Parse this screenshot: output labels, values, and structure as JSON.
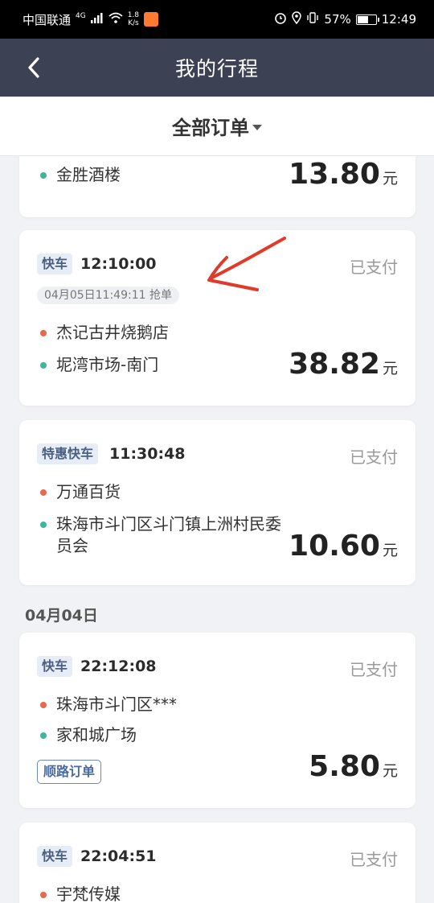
{
  "status_bar": {
    "carrier": "中国联通",
    "network": "4G",
    "speed_value": "1.8",
    "speed_unit": "K/s",
    "battery": "57%",
    "time": "12:49"
  },
  "header": {
    "title": "我的行程"
  },
  "filter": {
    "label": "全部订单"
  },
  "orders": [
    {
      "stops": [
        {
          "type": "end",
          "name": "金胜酒楼"
        }
      ],
      "amount": "13.80",
      "unit": "元"
    },
    {
      "tag": "快车",
      "time": "12:10:00",
      "status": "已支付",
      "grab_time": "04月05日11:49:11 抢单",
      "stops": [
        {
          "type": "start",
          "name": "杰记古井烧鹅店"
        },
        {
          "type": "end",
          "name": "坭湾市场-南门"
        }
      ],
      "amount": "38.82",
      "unit": "元"
    },
    {
      "tag": "特惠快车",
      "time": "11:30:48",
      "status": "已支付",
      "stops": [
        {
          "type": "start",
          "name": "万通百货"
        },
        {
          "type": "end",
          "name": "珠海市斗门区斗门镇上洲村民委员会"
        }
      ],
      "amount": "10.60",
      "unit": "元"
    },
    {
      "tag": "快车",
      "time": "22:12:08",
      "status": "已支付",
      "stops": [
        {
          "type": "start",
          "name": "珠海市斗门区***"
        },
        {
          "type": "end",
          "name": "家和城广场"
        }
      ],
      "badge": "顺路订单",
      "amount": "5.80",
      "unit": "元"
    },
    {
      "tag": "快车",
      "time": "22:04:51",
      "status": "已支付",
      "stops": [
        {
          "type": "start",
          "name": "宇梵传媒"
        }
      ]
    }
  ],
  "date_groups": [
    "04月04日"
  ],
  "colors": {
    "header_bg": "#3d4154",
    "start_dot": "#e56a4d",
    "end_dot": "#3fb59b",
    "annotation": "#e03a2a"
  }
}
